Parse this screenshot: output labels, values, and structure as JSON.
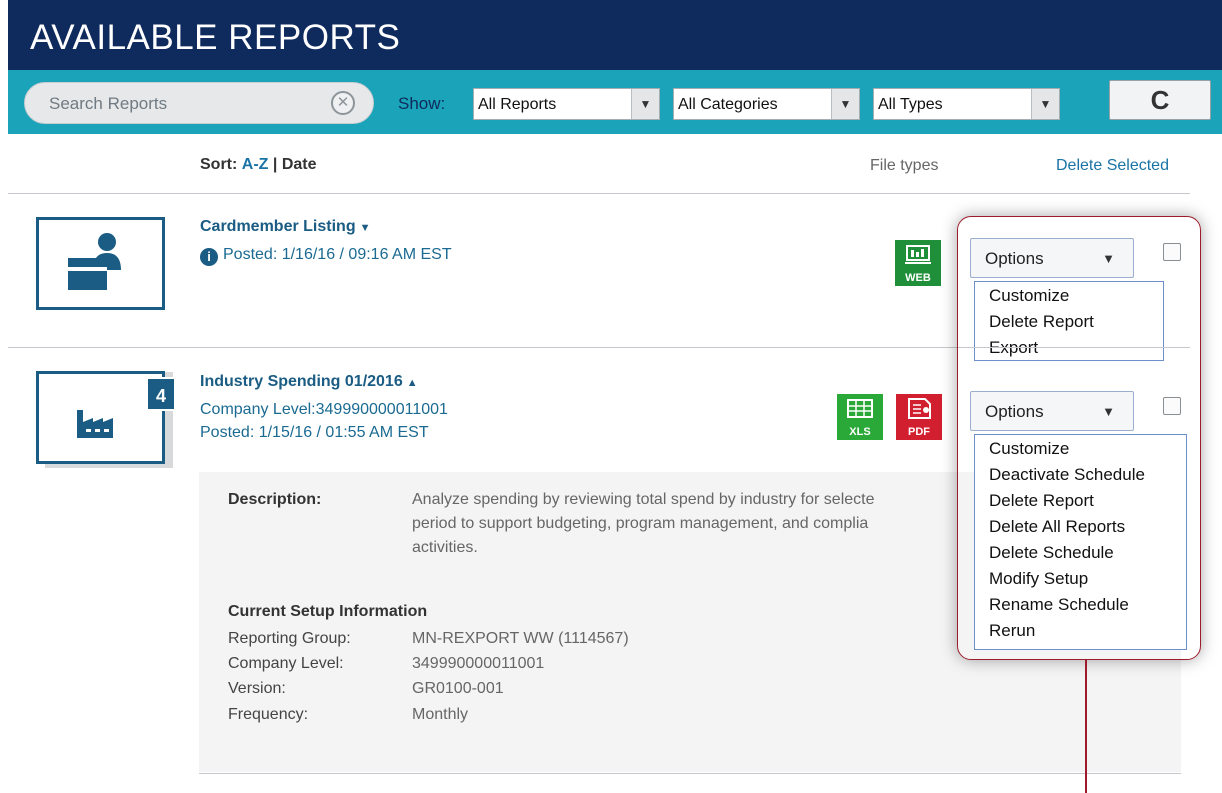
{
  "header": {
    "title": "AVAILABLE REPORTS"
  },
  "toolbar": {
    "search_placeholder": "Search Reports",
    "clear_glyph": "✕",
    "show_label": "Show:",
    "filters": [
      "All Reports",
      "All Categories",
      "All Types"
    ],
    "dropdown_glyph": "▼",
    "refresh_glyph": "C"
  },
  "sort": {
    "label": "Sort:",
    "az": "A-Z",
    "sep": "|",
    "date": "Date"
  },
  "columns": {
    "file_types": "File types",
    "delete_selected": "Delete Selected"
  },
  "reports": [
    {
      "title": "Cardmember Listing",
      "caret": "▼",
      "info_glyph": "i",
      "posted": "Posted: 1/16/16 / 09:16 AM EST",
      "file_types": [
        "WEB"
      ],
      "options_label": "Options",
      "options_arrow": "▼",
      "menu": [
        "Customize",
        "Delete Report",
        "Export"
      ]
    },
    {
      "title": "Industry Spending 01/2016",
      "caret": "▲",
      "badge": "4",
      "company_level": "Company Level:349990000011001",
      "posted": "Posted: 1/15/16 / 01:55 AM EST",
      "file_types": [
        "XLS",
        "PDF"
      ],
      "options_label": "Options",
      "options_arrow": "▼",
      "menu": [
        "Customize",
        "Deactivate Schedule",
        "Delete Report",
        "Delete All Reports",
        "Delete Schedule",
        "Modify Setup",
        "Rename Schedule",
        "Rerun"
      ],
      "description_label": "Description:",
      "description_lines": [
        "Analyze spending by reviewing total spend by industry for selecte",
        "period to support budgeting, program management, and complia",
        "activities."
      ],
      "setup_heading": "Current Setup Information",
      "setup": [
        {
          "key": "Reporting Group:",
          "value": "MN-REXPORT WW (1114567)"
        },
        {
          "key": "Company Level:",
          "value": "349990000011001"
        },
        {
          "key": "Version:",
          "value": "GR0100-001"
        },
        {
          "key": "Frequency:",
          "value": "Monthly"
        }
      ]
    }
  ],
  "colors": {
    "header_bg": "#0f2a5c",
    "toolbar_bg": "#1aa3b9",
    "accent": "#1a5c83",
    "web_green": "#1f8f3a",
    "xls_green": "#2aa838",
    "pdf_red": "#d11f30",
    "highlight": "#9c1c2c"
  }
}
